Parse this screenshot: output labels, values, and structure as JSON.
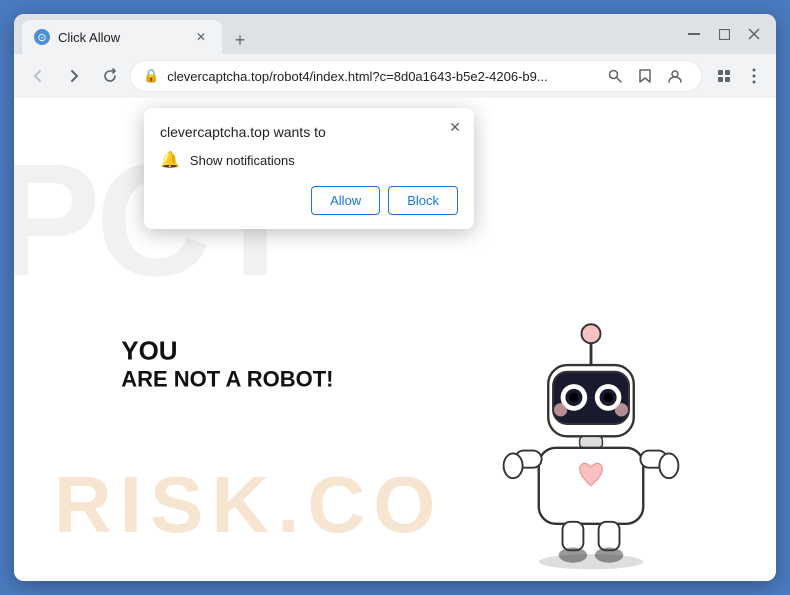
{
  "browser": {
    "tab": {
      "title": "Click Allow",
      "favicon": "●"
    },
    "address_bar": {
      "url": "clevercaptcha.top/robot4/index.html?c=8d0a1643-b5e2-4206-b9...",
      "lock_icon": "🔒"
    },
    "nav": {
      "back": "←",
      "forward": "→",
      "reload": "↻"
    },
    "window_controls": {
      "minimize": "—",
      "maximize": "□",
      "close": "✕"
    }
  },
  "popup": {
    "title": "clevercaptcha.top wants to",
    "notification_label": "Show notifications",
    "allow_button": "Allow",
    "block_button": "Block",
    "close_icon": "✕"
  },
  "page": {
    "main_text_line1": "YOU",
    "main_text_line2": "ARE NOT A ROBOT!",
    "watermark_top": "PCT",
    "watermark_bottom": "RISK.CO"
  },
  "colors": {
    "browser_bg": "#dee1e6",
    "tab_active": "#f1f3f4",
    "webpage_bg": "#ffffff",
    "allow_btn_color": "#1a73e8",
    "block_btn_color": "#1a73e8",
    "outer_border": "#4a7abf"
  }
}
